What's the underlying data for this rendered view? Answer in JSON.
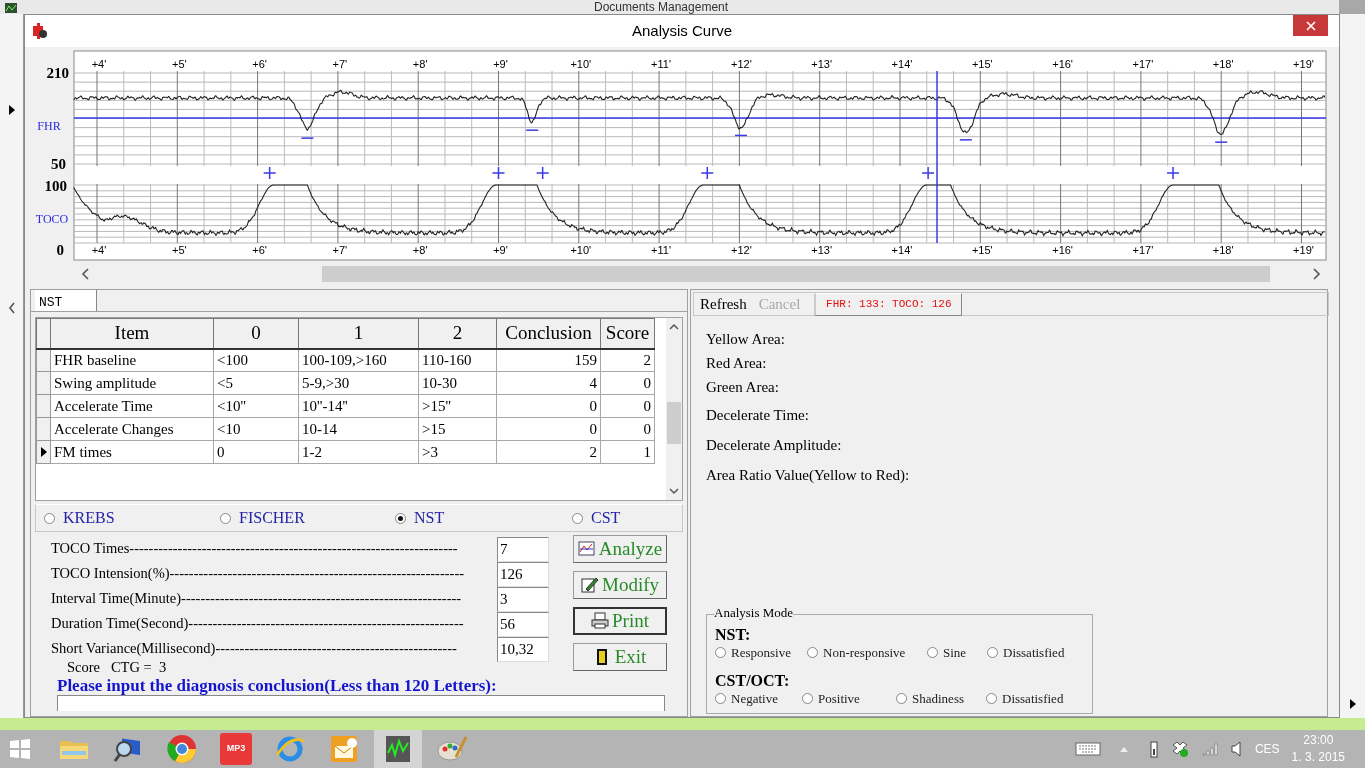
{
  "background_window": {
    "title": "Documents Management"
  },
  "window": {
    "title": "Analysis Curve"
  },
  "chart": {
    "fhr_label": "FHR",
    "toco_label": "TOCO",
    "fhr_axis": [
      "210",
      "50"
    ],
    "toco_axis": [
      "100",
      "0"
    ],
    "time_ticks_top": [
      "+4'",
      "+5'",
      "+6'",
      "+7'",
      "+8'",
      "+9'",
      "+10'",
      "+11'",
      "+12'",
      "+13'",
      "+14'",
      "+15'",
      "+16'",
      "+17'",
      "+18'",
      "+19'"
    ],
    "time_ticks_bottom": [
      "+4'",
      "+5'",
      "+6'",
      "+7'",
      "+8'",
      "+9'",
      "+10'",
      "+11'",
      "+12'",
      "+13'",
      "+14'",
      "+15'",
      "+16'",
      "+17'",
      "+18'",
      "+19'"
    ]
  },
  "tabs": [
    {
      "label": "NST",
      "selected": true
    }
  ],
  "table": {
    "columns": [
      "Item",
      "0",
      "1",
      "2",
      "Conclusion",
      "Score"
    ],
    "rows": [
      {
        "cells": [
          "FHR baseline",
          "<100",
          "100-109,>160",
          "110-160",
          "159",
          "2"
        ],
        "selected": false
      },
      {
        "cells": [
          "Swing amplitude",
          "<5",
          "5-9,>30",
          "10-30",
          "4",
          "0"
        ],
        "selected": false
      },
      {
        "cells": [
          "Accelerate Time",
          "<10''",
          "10''-14''",
          ">15''",
          "0",
          "0"
        ],
        "selected": false
      },
      {
        "cells": [
          "Accelerate Changes",
          "<10",
          "10-14",
          ">15",
          "0",
          "0"
        ],
        "selected": false
      },
      {
        "cells": [
          "FM times",
          "0",
          "1-2",
          ">3",
          "2",
          "1"
        ],
        "selected": true
      }
    ]
  },
  "methods": [
    {
      "label": "KREBS",
      "selected": false
    },
    {
      "label": "FISCHER",
      "selected": false
    },
    {
      "label": "NST",
      "selected": true
    },
    {
      "label": "CST",
      "selected": false
    }
  ],
  "fields": [
    {
      "label": "TOCO Times--------------------------------------------------------------------",
      "value": "7"
    },
    {
      "label": "TOCO Intension(%)-------------------------------------------------------------",
      "value": "126"
    },
    {
      "label": "Interval Time(Minute)----------------------------------------------------------",
      "value": "3"
    },
    {
      "label": "Duration Time(Second)---------------------------------------------------------",
      "value": "56"
    },
    {
      "label": "Short Variance(Millisecond)--------------------------------------------------",
      "value": "10,32"
    }
  ],
  "score": "Score   CTG =  3",
  "buttons": [
    {
      "label": "Analyze",
      "kind": "analyze",
      "focused": false
    },
    {
      "label": "Modify",
      "kind": "modify",
      "focused": false
    },
    {
      "label": "Print",
      "kind": "print",
      "focused": true
    },
    {
      "label": "Exit",
      "kind": "exit",
      "focused": false
    }
  ],
  "prompt": "Please input the diagnosis conclusion(Less than 120 Letters):",
  "toolbar": [
    {
      "label": "Refresh",
      "disabled": false
    },
    {
      "label": "Cancel",
      "disabled": true
    }
  ],
  "status": "FHR: 133: TOCO: 126",
  "results": [
    "Yellow Area:",
    "Red Area:",
    "Green Area:",
    "Decelerate Time:",
    "Decelerate Amplitude:",
    "Area Ratio Value(Yellow to Red):"
  ],
  "analysis_mode": {
    "title": "Analysis Mode",
    "groups": [
      {
        "label": "NST:",
        "options": [
          {
            "label": "Responsive",
            "selected": false
          },
          {
            "label": "Non-responsive",
            "selected": false
          },
          {
            "label": "Sine",
            "selected": false
          },
          {
            "label": "Dissatisfied",
            "selected": false
          }
        ]
      },
      {
        "label": "CST/OCT:",
        "options": [
          {
            "label": "Negative",
            "selected": false
          },
          {
            "label": "Positive",
            "selected": false
          },
          {
            "label": "Shadiness",
            "selected": false
          },
          {
            "label": "Dissatisfied",
            "selected": false
          }
        ]
      }
    ]
  },
  "taskbar": {
    "apps": [
      {
        "kind": "folder",
        "active": false
      },
      {
        "kind": "search",
        "active": false
      },
      {
        "kind": "browser",
        "active": false
      },
      {
        "kind": "mp3",
        "label": "MP3",
        "active": false
      },
      {
        "kind": "ring",
        "active": false
      },
      {
        "kind": "mail",
        "active": false
      },
      {
        "kind": "ctg",
        "active": true
      },
      {
        "kind": "paint",
        "active": false
      }
    ],
    "language": "CES",
    "time": "23:00",
    "date": "1. 3. 2015"
  }
}
